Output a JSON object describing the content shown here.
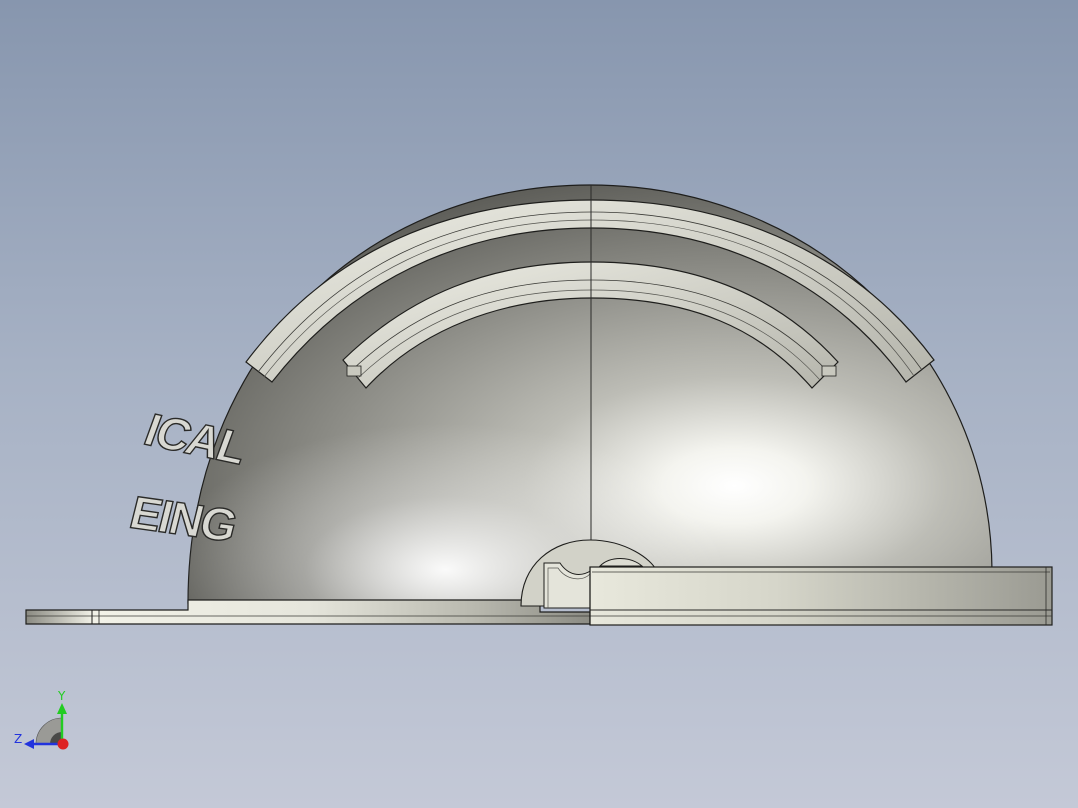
{
  "model": {
    "emboss_line_1": "ICAL",
    "emboss_line_2": "EING"
  },
  "triad": {
    "y_label": "Y",
    "z_label": "Z",
    "y_color": "#22cc22",
    "z_color": "#2233dd",
    "x_color": "#dd2222"
  },
  "colors": {
    "background_top": "#8796ae",
    "background_bottom": "#c4c9d7",
    "model_edge": "#1e1e1c"
  }
}
